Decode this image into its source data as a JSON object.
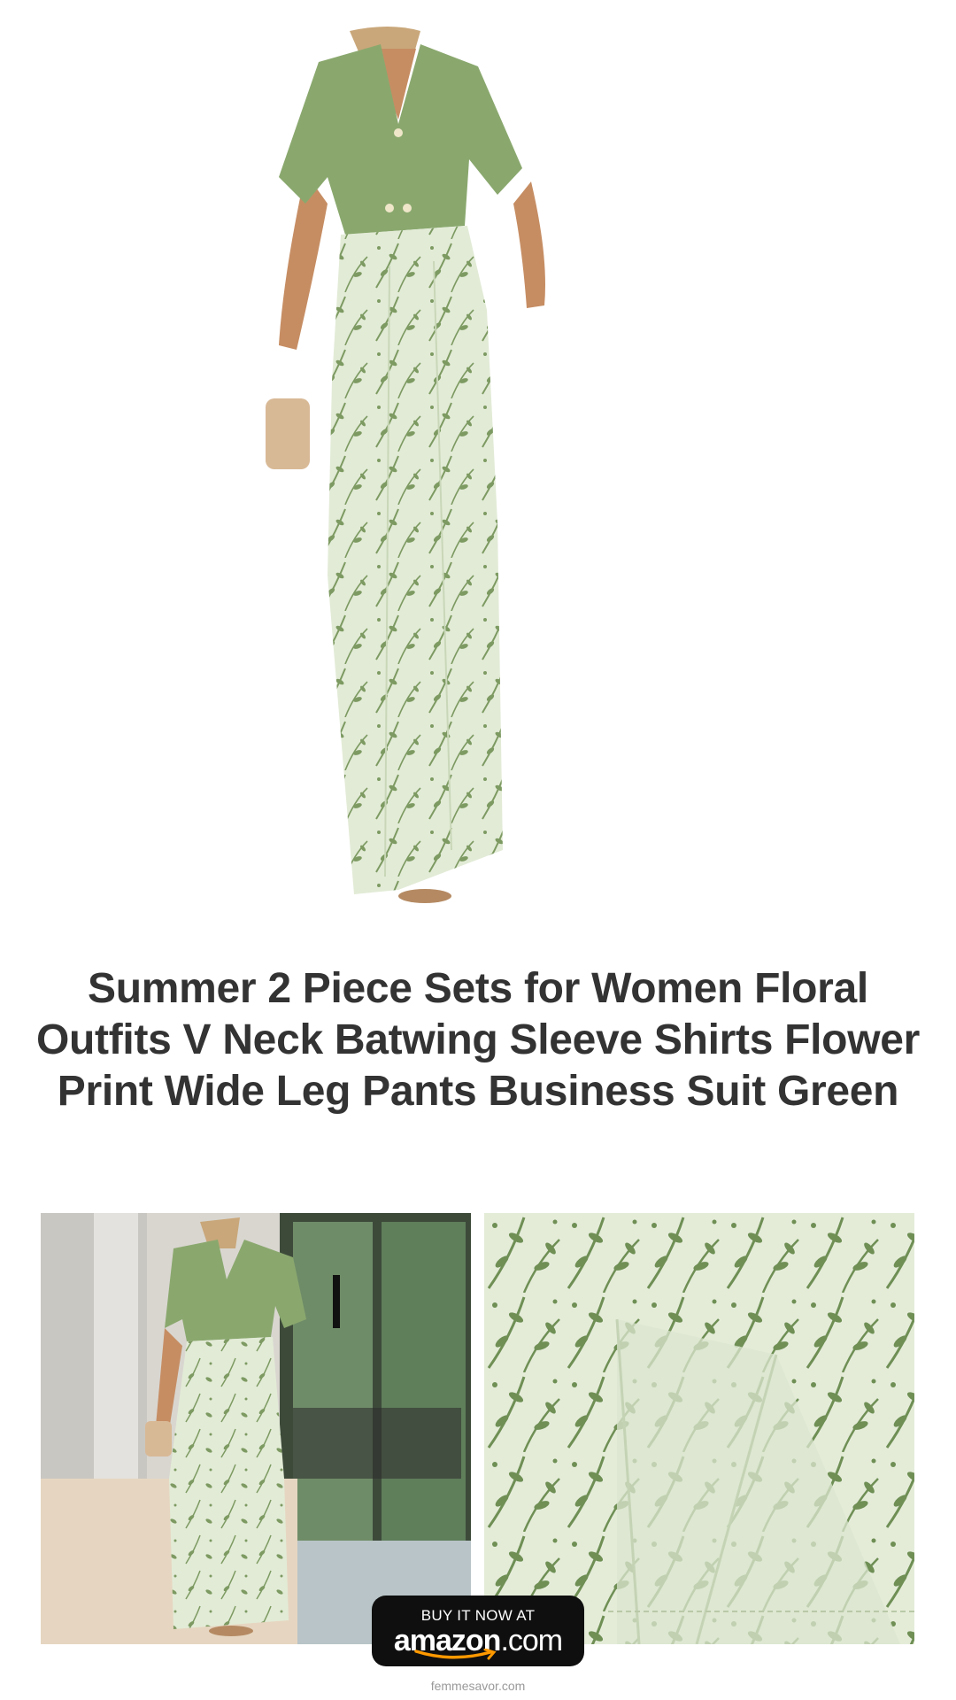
{
  "product": {
    "title": "Summer 2 Piece Sets for Women Floral Outfits V Neck Batwing Sleeve Shirts Flower Print Wide Leg Pants Business Suit Green"
  },
  "cta": {
    "line1": "BUY IT NOW AT",
    "brand": "amazon",
    "brand_suffix": ".com"
  },
  "footer": {
    "site": "femmesavor.com"
  },
  "colors": {
    "top_green": "#8aa86e",
    "print_bg": "#dfe9d2",
    "print_leaf": "#7d9a62",
    "amazon_orange": "#ff9900"
  }
}
